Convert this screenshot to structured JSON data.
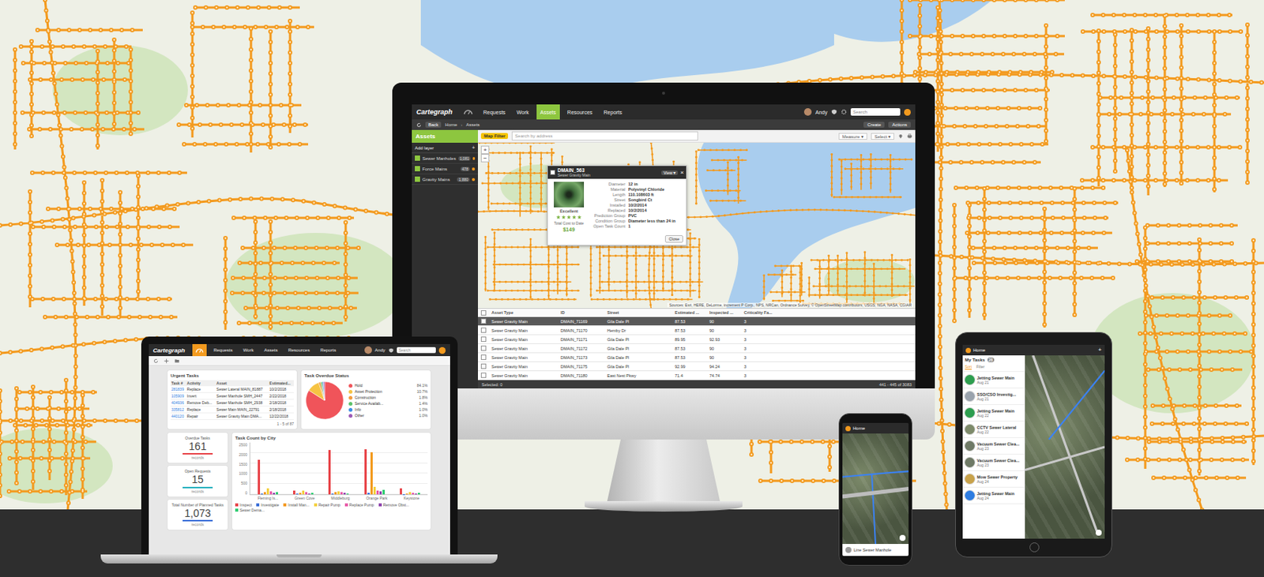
{
  "brand": "Cartegraph",
  "monitor": {
    "home": {
      "selected": false
    },
    "nav": [
      {
        "label": "Requests",
        "selected": false
      },
      {
        "label": "Work",
        "selected": false
      },
      {
        "label": "Assets",
        "selected": true
      },
      {
        "label": "Resources",
        "selected": false
      },
      {
        "label": "Reports",
        "selected": false
      }
    ],
    "user": "Andy",
    "search": {
      "placeholder": "Search"
    },
    "subbar": {
      "back": "Back",
      "breadcrumb": [
        "Home",
        "Assets"
      ],
      "separator": "›",
      "actions": [
        "Create",
        "Actions"
      ]
    },
    "layers": {
      "title": "Assets",
      "add": "Add layer",
      "add_icon": "+",
      "items": [
        {
          "name": "Sewer Manholes",
          "count": "1,081",
          "checked": true
        },
        {
          "name": "Force Mains",
          "count": "478",
          "checked": true
        },
        {
          "name": "Gravity Mains",
          "count": "1,880",
          "checked": true
        }
      ]
    },
    "map_toolbar": {
      "filter": "Map Filter",
      "search_placeholder": "Search by address",
      "tools": [
        "Measure",
        "Select"
      ]
    },
    "zoom": [
      "+",
      "−"
    ],
    "popup": {
      "title": "DMAIN_563",
      "subtitle": "Sewer Gravity Main",
      "view": "View",
      "close_icon": "×",
      "rating": "Excellent",
      "stars": 5,
      "cost_label": "Total Cost to Date",
      "cost": "$149",
      "fields": [
        {
          "label": "Diameter",
          "value": "12 in"
        },
        {
          "label": "Material",
          "value": "Polyvinyl Chloride"
        },
        {
          "label": "Length",
          "value": "110.108603 ft"
        },
        {
          "label": "Street",
          "value": "Songbird Ct"
        },
        {
          "label": "Installed",
          "value": "10/2/2014"
        },
        {
          "label": "Replaced",
          "value": "10/2/2014"
        },
        {
          "label": "Prediction Group",
          "value": "PVC"
        },
        {
          "label": "Condition Group",
          "value": "Diameter less than 24 in"
        },
        {
          "label": "Open Task Count",
          "value": "1"
        }
      ],
      "close": "Close"
    },
    "attribution": "Sources: Esri, HERE, DeLorme, increment P Corp., NPS, NRCan, Ordnance Survey, © OpenStreetMap contributors, USGS, NGA, NASA, CGIAR",
    "table": {
      "columns": [
        "Asset Type",
        "ID",
        "Street",
        "Estimated ...",
        "Inspected ...",
        "Criticality Fa..."
      ],
      "rows": [
        {
          "cells": [
            "Sewer Gravity Main",
            "DMAIN_71169",
            "Gila Dale Pl",
            "87.53",
            "90",
            "3"
          ],
          "selected": true
        },
        {
          "cells": [
            "Sewer Gravity Main",
            "DMAIN_71170",
            "Hemby Dr",
            "87.53",
            "90",
            "3"
          ],
          "selected": false
        },
        {
          "cells": [
            "Sewer Gravity Main",
            "DMAIN_71171",
            "Gila Dale Pl",
            "89.95",
            "92.93",
            "3"
          ],
          "selected": false
        },
        {
          "cells": [
            "Sewer Gravity Main",
            "DMAIN_71172",
            "Gila Dale Pl",
            "87.53",
            "90",
            "3"
          ],
          "selected": false
        },
        {
          "cells": [
            "Sewer Gravity Main",
            "DMAIN_71173",
            "Gila Dale Pl",
            "87.53",
            "90",
            "3"
          ],
          "selected": false
        },
        {
          "cells": [
            "Sewer Gravity Main",
            "DMAIN_71175",
            "Gila Dale Pl",
            "92.99",
            "94.24",
            "3"
          ],
          "selected": false
        },
        {
          "cells": [
            "Sewer Gravity Main",
            "DMAIN_71180",
            "East Nest Pkwy",
            "71.4",
            "74.74",
            "3"
          ],
          "selected": false
        }
      ],
      "footer_left": "Selected: 0",
      "footer_right": "441 - 445 of 3083"
    }
  },
  "laptop": {
    "home": {
      "selected": true
    },
    "nav": [
      {
        "label": "Requests",
        "selected": false
      },
      {
        "label": "Work",
        "selected": false
      },
      {
        "label": "Assets",
        "selected": false
      },
      {
        "label": "Resources",
        "selected": false
      },
      {
        "label": "Reports",
        "selected": false
      }
    ],
    "user": "Andy",
    "search": {
      "placeholder": "Search"
    },
    "urgent": {
      "title": "Urgent Tasks",
      "columns": [
        "Task #",
        "Activity",
        "Asset",
        "Estimated..."
      ],
      "rows": [
        [
          "281839",
          "Replace",
          "Sewer Lateral MAIN_81887",
          "10/2/2018"
        ],
        [
          "105909",
          "Invert",
          "Sewer Manhole SMH_2447",
          "2/22/2018"
        ],
        [
          "404936",
          "Remove Deb...",
          "Sewer Manhole SMH_2938",
          "2/18/2018"
        ],
        [
          "335812",
          "Replace",
          "Sewer Main MAIN_22791",
          "2/18/2018"
        ],
        [
          "440120",
          "Repair",
          "Sewer Gravity Main DMA...",
          "12/22/2018"
        ]
      ],
      "pager": "1 - 5 of 87"
    },
    "pie": {
      "title": "Task Overdue Status",
      "slices": [
        {
          "label": "Hold",
          "value": 84.1,
          "reading": "84.1%",
          "color": "#f0545a"
        },
        {
          "label": "Asset Protection",
          "value": 10.7,
          "reading": "10.7%",
          "color": "#f6c343"
        },
        {
          "label": "Construction",
          "value": 1.8,
          "reading": "1.8%",
          "color": "#f39a3c"
        },
        {
          "label": "Service Availab...",
          "value": 1.4,
          "reading": "1.4%",
          "color": "#5cc26a"
        },
        {
          "label": "Info",
          "value": 1.0,
          "reading": "1.0%",
          "color": "#3a8ee6"
        },
        {
          "label": "Other",
          "value": 1.0,
          "reading": "1.0%",
          "color": "#9b59b6"
        }
      ]
    },
    "kpis": [
      {
        "title": "Overdue Tasks",
        "value": "161",
        "unit": "records",
        "color": "#e8454a"
      },
      {
        "title": "Open Requests",
        "value": "15",
        "unit": "records",
        "color": "#2bb3c0"
      },
      {
        "title": "Total Number of Planned Tasks",
        "value": "1,073",
        "unit": "records",
        "color": "#3a6fd8"
      }
    ],
    "bars": {
      "title": "Task Count by City",
      "ticks": [
        "2500",
        "2000",
        "1500",
        "1000",
        "500",
        "0"
      ],
      "categories": [
        "Fleming Is...",
        "Green Cove",
        "Middleburg",
        "Orange Park",
        "Keystone"
      ],
      "series": [
        {
          "name": "Inspect",
          "color": "#e8454a",
          "values": [
            1800,
            200,
            2300,
            2350,
            300
          ]
        },
        {
          "name": "Investigate",
          "color": "#3a6fd8",
          "values": [
            50,
            30,
            60,
            80,
            20
          ]
        },
        {
          "name": "Install Man...",
          "color": "#f39a1e",
          "values": [
            100,
            80,
            120,
            2200,
            60
          ]
        },
        {
          "name": "Repair Pump",
          "color": "#f4d03f",
          "values": [
            300,
            200,
            150,
            400,
            100
          ]
        },
        {
          "name": "Replace Pump",
          "color": "#e85aa8",
          "values": [
            150,
            120,
            100,
            200,
            80
          ]
        },
        {
          "name": "Remove Obst...",
          "color": "#8e44ad",
          "values": [
            80,
            60,
            70,
            150,
            40
          ]
        },
        {
          "name": "Sewer Dema...",
          "color": "#2ecc71",
          "values": [
            120,
            90,
            60,
            220,
            70
          ]
        }
      ]
    }
  },
  "phone": {
    "title": "Home",
    "card": "Line Sewer Manhole"
  },
  "tablet": {
    "title": "Home",
    "add": "+",
    "list_title": "My Tasks",
    "count": "28",
    "tabs": [
      {
        "label": "Sort",
        "selected": true
      },
      {
        "label": "Filter",
        "selected": false
      }
    ],
    "tasks": [
      {
        "title": "Jetting Sewer Main",
        "meta": "Aug 21",
        "color": "#2e9e4f"
      },
      {
        "title": "SSO/CSO Investig...",
        "meta": "Aug 21",
        "color": "#9aa3ad"
      },
      {
        "title": "Jetting Sewer Main",
        "meta": "Aug 22",
        "color": "#2e9e4f"
      },
      {
        "title": "CCTV Sewer Lateral",
        "meta": "Aug 22",
        "color": "#7d8a6a"
      },
      {
        "title": "Vacuum Sewer Clea...",
        "meta": "Aug 23",
        "color": "#6f7a66"
      },
      {
        "title": "Vacuum Sewer Clea...",
        "meta": "Aug 23",
        "color": "#6f7a66"
      },
      {
        "title": "Mow Sewer Property",
        "meta": "Aug 24",
        "color": "#c8a24a"
      },
      {
        "title": "Jetting Sewer Main",
        "meta": "Aug 24",
        "color": "#2f7de1"
      }
    ]
  }
}
